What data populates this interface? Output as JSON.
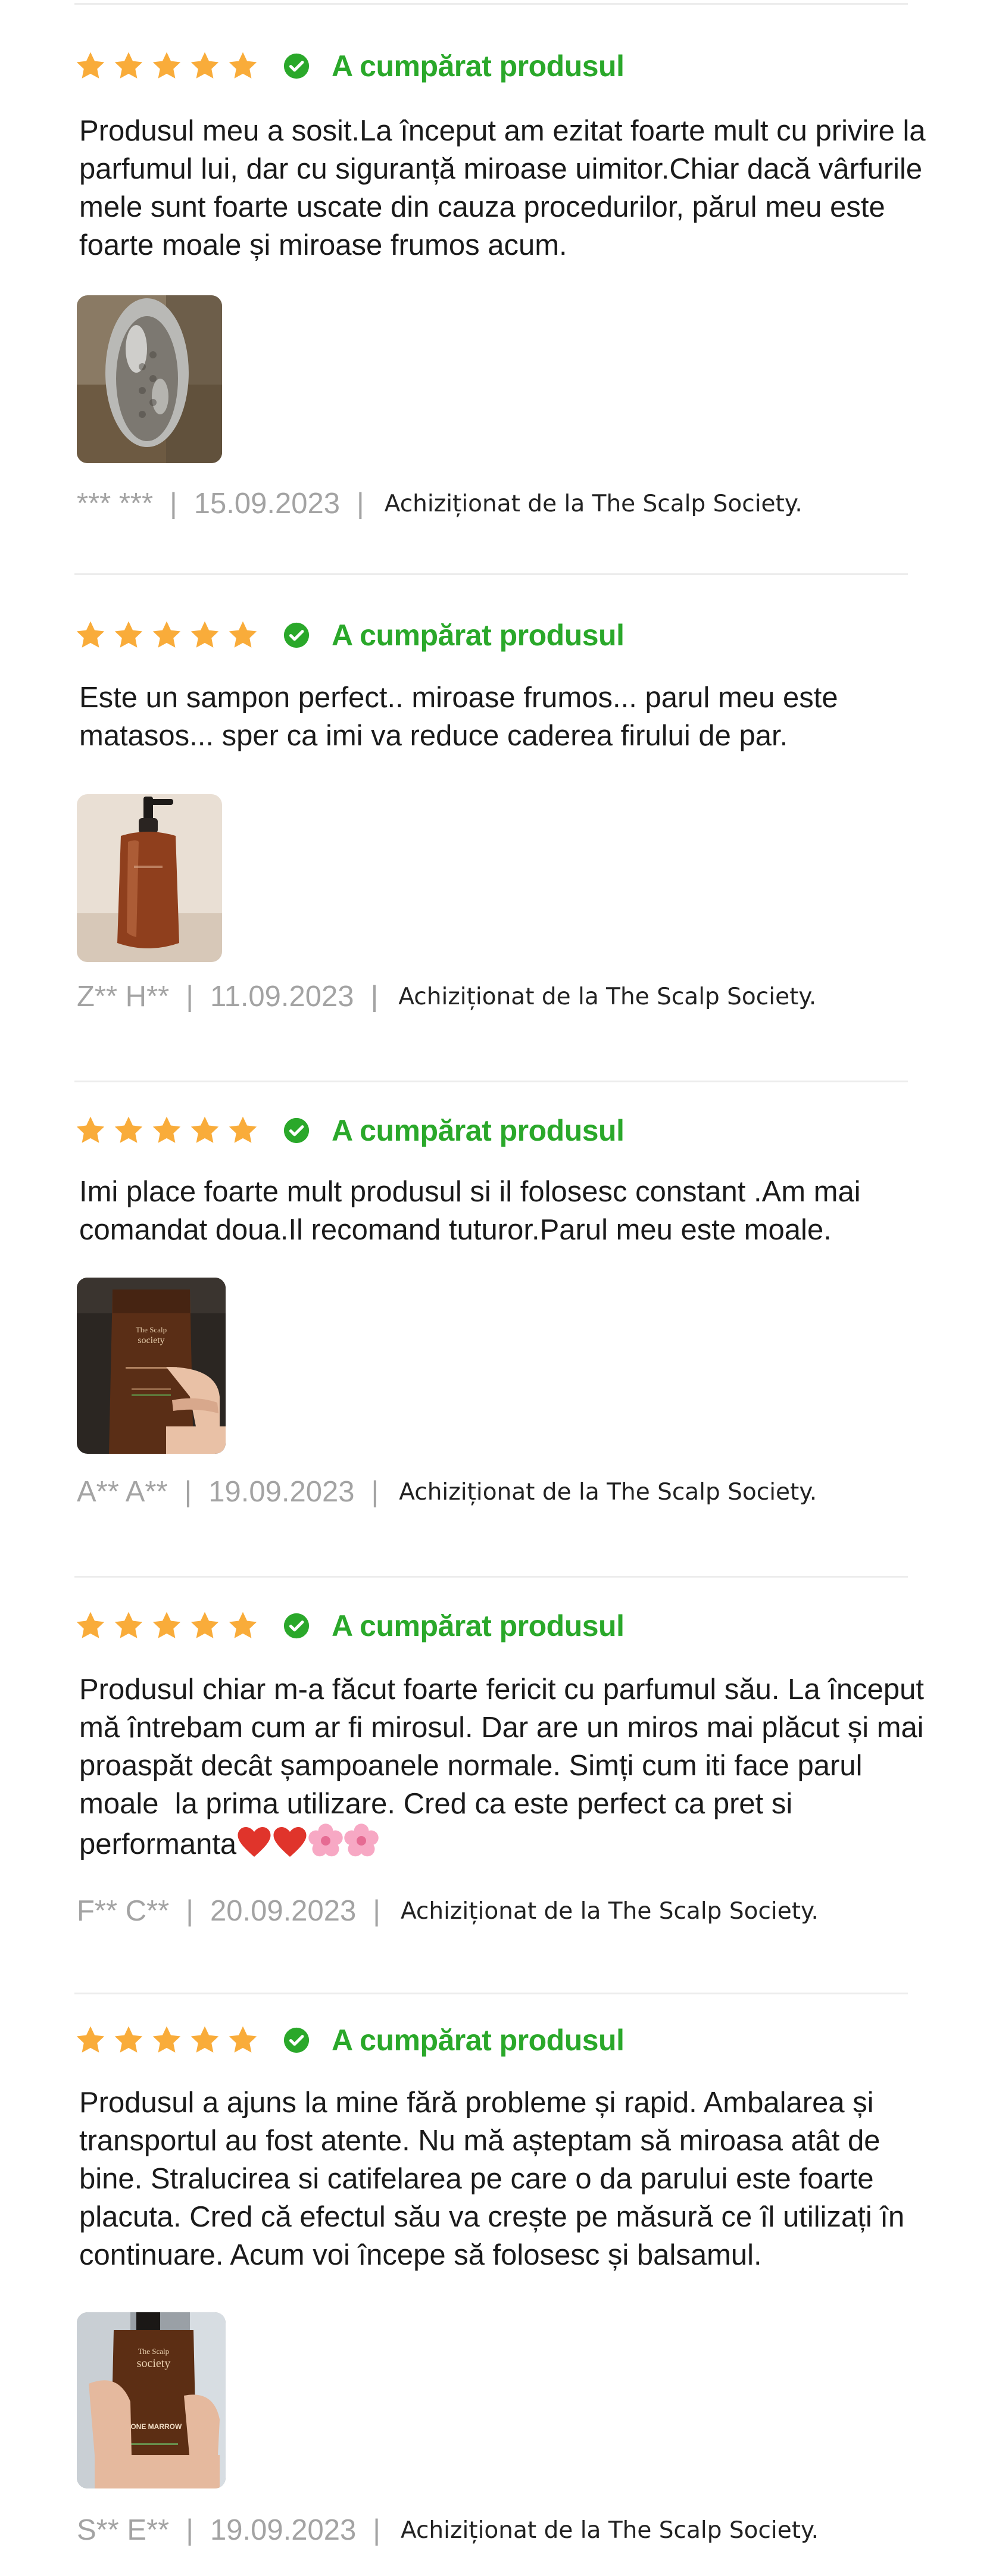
{
  "colors": {
    "star": "#f9ac3a",
    "verified": "#2aa82a",
    "muted_text": "#a3a3a3",
    "divider": "#ececec"
  },
  "reviews": [
    {
      "rating": 5,
      "verified_label": "A cumpărat produsul",
      "text": "Produsul meu a sosit.La început am ezitat foarte mult cu privire la parfumul lui, dar cu siguranță miroase uimitor.Chiar dacă vârfurile mele sunt foarte uscate din cauza procedurilor, părul meu este foarte moale și miroase frumos acum.",
      "photo": "bottle-wrapped-in-bubble-wrap",
      "author": "*** ***",
      "date": "15.09.2023",
      "source": "Achiziționat de la The Scalp Society."
    },
    {
      "rating": 5,
      "verified_label": "A cumpărat produsul",
      "text": "Este un sampon perfect.. miroase frumos... parul meu este matasos... sper ca imi va reduce caderea firului de par.",
      "photo": "amber-pump-bottle",
      "author": "Z** H**",
      "date": "11.09.2023",
      "source": "Achiziționat de la The Scalp Society."
    },
    {
      "rating": 5,
      "verified_label": "A cumpărat produsul",
      "text": "Imi place foarte mult produsul si il folosesc constant .Am mai comandat doua.Il recomand tuturor.Parul meu este moale.",
      "photo": "hand-holding-bottle",
      "author": "A** A**",
      "date": "19.09.2023",
      "source": "Achiziționat de la The Scalp Society."
    },
    {
      "rating": 5,
      "verified_label": "A cumpărat produsul",
      "text": "Produsul chiar m-a făcut foarte fericit cu parfumul său. La început mă întrebam cum ar fi mirosul. Dar are un miros mai plăcut și mai proaspăt decât șampoanele normale. Simți cum iti face parul moale  la prima utilizare. Cred ca este perfect ca pret si performanta",
      "emoji": [
        "❤️",
        "❤️",
        "🌸",
        "🌸"
      ],
      "author": "F** C**",
      "date": "20.09.2023",
      "source": "Achiziționat de la The Scalp Society."
    },
    {
      "rating": 5,
      "verified_label": "A cumpărat produsul",
      "text": "Produsul a ajuns la mine fără probleme și rapid. Ambalarea și transportul au fost atente. Nu mă așteptam să miroasa atât de bine. Stralucirea si catifelarea pe care o da parului este foarte placuta. Cred că efectul său va crește pe măsură ce îl utilizați în continuare. Acum voi începe să folosesc și balsamul.",
      "photo": "hand-holding-bottle-closeup",
      "author": "S** E**",
      "date": "19.09.2023",
      "source": "Achiziționat de la The Scalp Society."
    }
  ]
}
